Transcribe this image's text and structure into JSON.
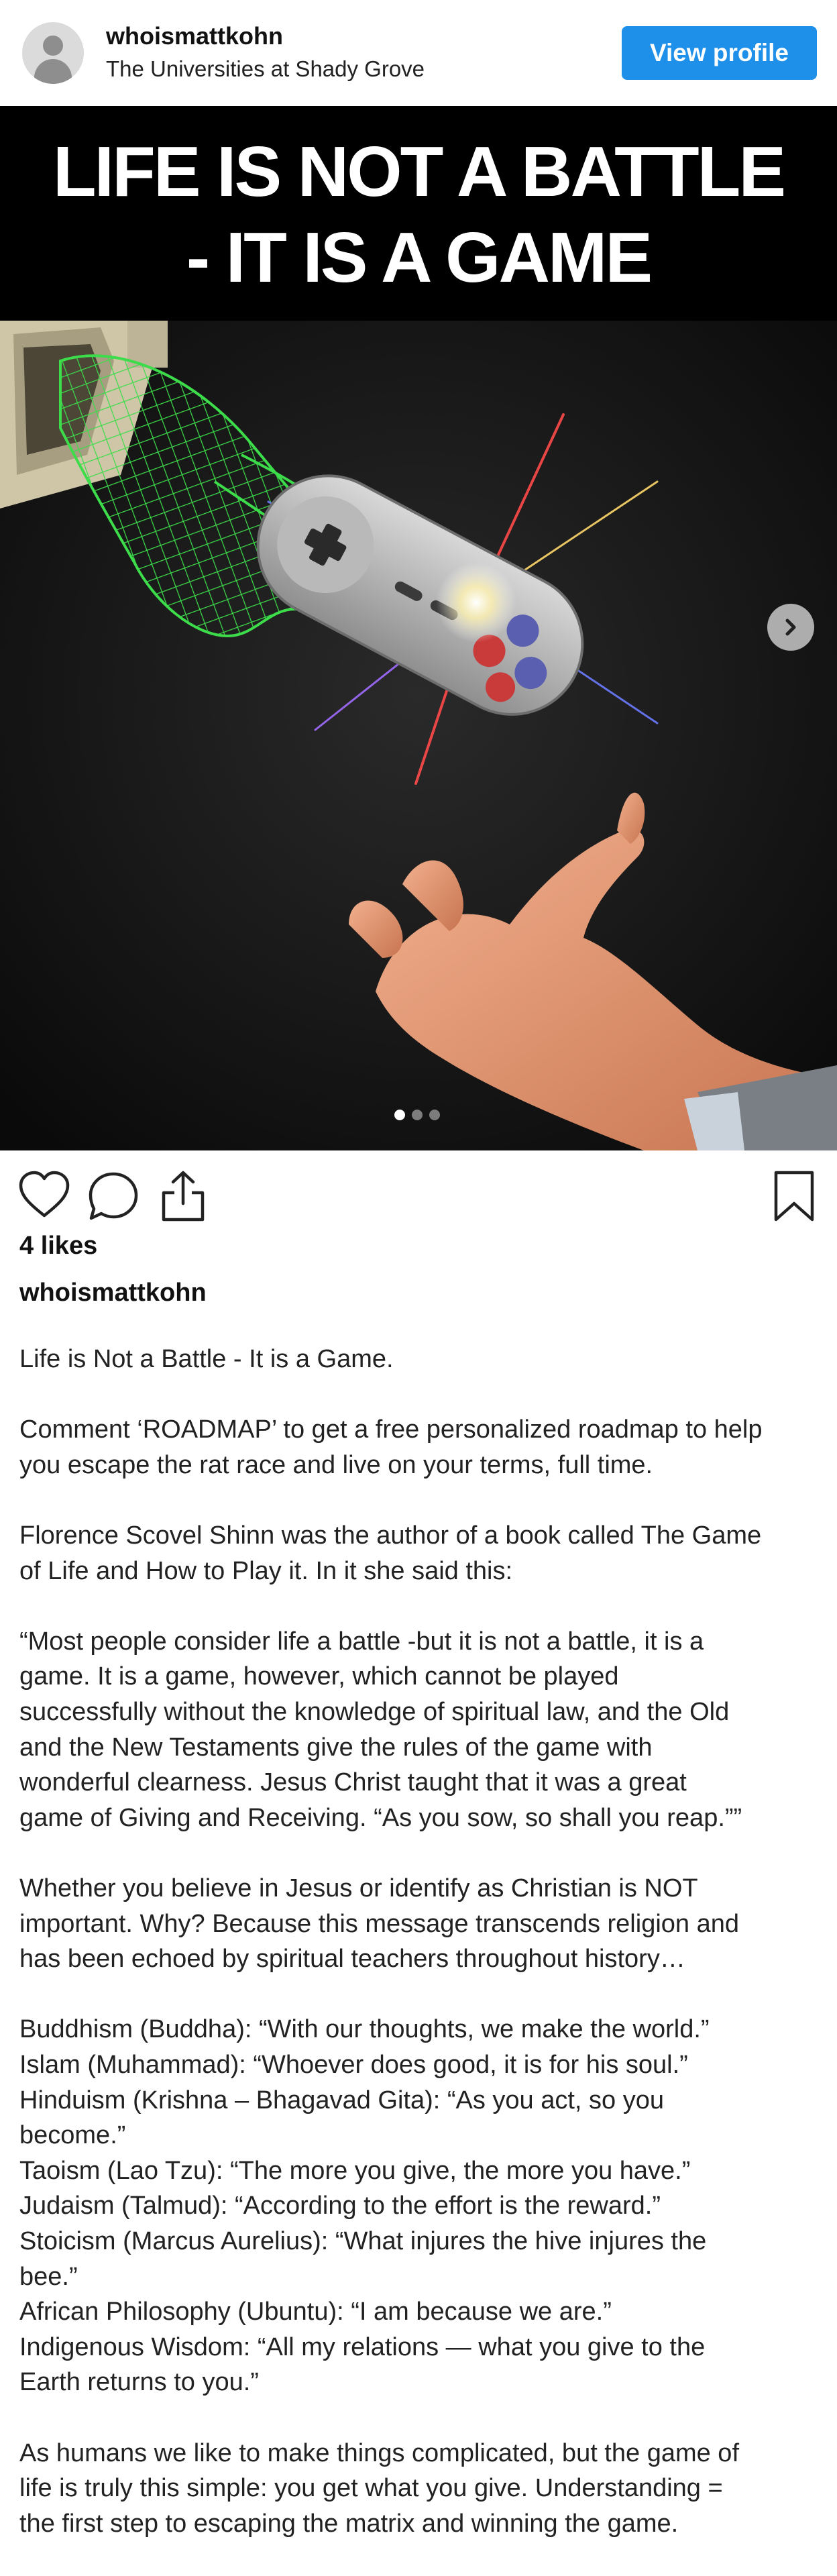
{
  "header": {
    "username": "whoismattkohn",
    "location": "The Universities at Shady Grove",
    "view_profile_label": "View profile"
  },
  "media": {
    "banner_line1": "LIFE IS NOT A BATTLE",
    "banner_line2": "- IT IS A GAME",
    "image_description_icon": "wireframe-hand-passing-controller-image",
    "carousel_count": 3,
    "carousel_active_index": 0
  },
  "actions": {
    "icons": [
      "heart-icon",
      "comment-icon",
      "share-icon",
      "bookmark-icon"
    ]
  },
  "post": {
    "likes": "4 likes",
    "caption_username": "whoismattkohn",
    "caption_lines": [
      "Life is Not a Battle - It is a Game.",
      "",
      "Comment ‘ROADMAP’ to get a free personalized roadmap to help",
      "you escape the rat race and live on your terms, full time.",
      "",
      "Florence Scovel Shinn was the author of a book called The Game",
      "of Life and How to Play it. In it she said this:",
      "",
      "“Most people consider life a battle -but it is not a battle, it is a",
      "game. It is a game, however, which cannot be played",
      "successfully without the knowledge of spiritual law, and the Old",
      "and the New Testaments give the rules of the game with",
      "wonderful clearness. Jesus Christ taught that it was a great",
      "game of Giving and Receiving. “As you sow, so shall you reap.””",
      "",
      "Whether you believe in Jesus or identify as Christian is NOT",
      "important. Why? Because this message transcends religion and",
      "has been echoed by spiritual teachers throughout history…",
      "",
      "Buddhism (Buddha): “With our thoughts, we make the world.”",
      "Islam (Muhammad): “Whoever does good, it is for his soul.”",
      "Hinduism (Krishna – Bhagavad Gita): “As you act, so you",
      "become.”",
      "Taoism (Lao Tzu): “The more you give, the more you have.”",
      "Judaism (Talmud): “According to the effort is the reward.”",
      "Stoicism (Marcus Aurelius): “What injures the hive injures the",
      "bee.”",
      "African Philosophy (Ubuntu): “I am because we are.”",
      "Indigenous Wisdom: “All my relations — what you give to the",
      "Earth returns to you.”",
      "",
      "As humans we like to make things complicated, but the game of",
      "life is truly this simple: you get what you give. Understanding =",
      "the first step to escaping the matrix and winning the game."
    ]
  },
  "colors": {
    "accent": "#1e90ea",
    "wireframe": "#3ddc4a",
    "background": "#ffffff"
  }
}
